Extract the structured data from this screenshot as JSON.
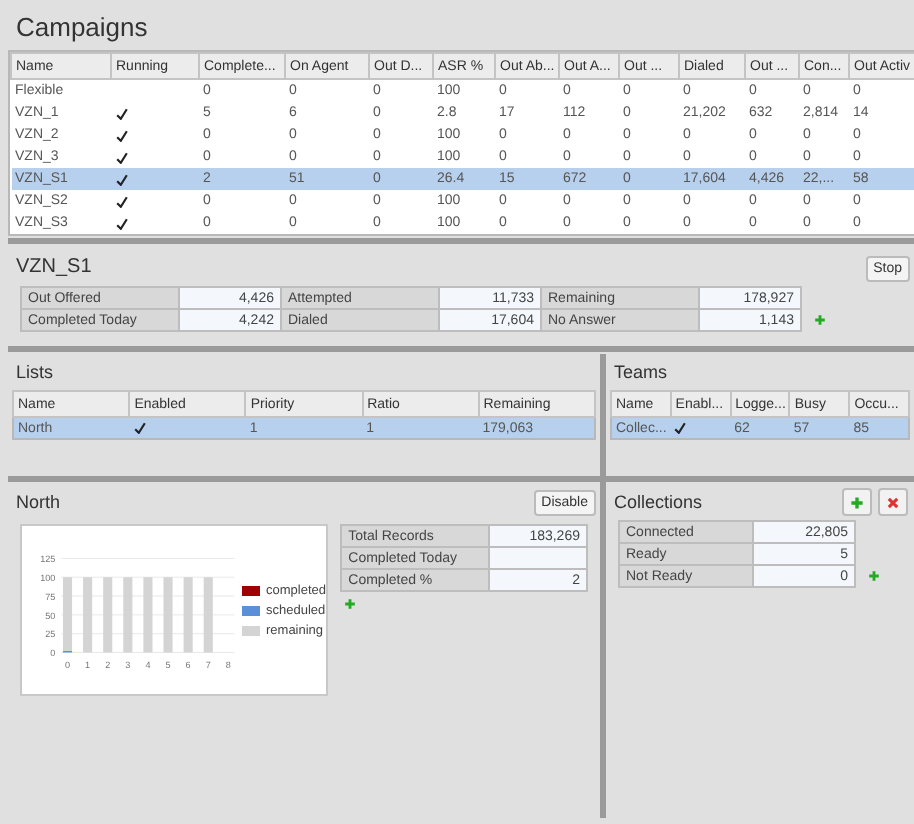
{
  "campaigns": {
    "title": "Campaigns",
    "columns": [
      "Name",
      "Running",
      "Complete...",
      "On Agent",
      "Out D...",
      "ASR %",
      "Out Ab...",
      "Out A...",
      "Out ...",
      "Dialed",
      "Out ...",
      "Con...",
      "Out Activ"
    ],
    "rows": [
      {
        "name": "Flexible",
        "running": false,
        "selected": false,
        "values": [
          "0",
          "0",
          "0",
          "100",
          "0",
          "0",
          "0",
          "0",
          "0",
          "0",
          "0"
        ]
      },
      {
        "name": "VZN_1",
        "running": true,
        "selected": false,
        "values": [
          "5",
          "6",
          "0",
          "2.8",
          "17",
          "112",
          "0",
          "21,202",
          "632",
          "2,814",
          "14"
        ]
      },
      {
        "name": "VZN_2",
        "running": true,
        "selected": false,
        "values": [
          "0",
          "0",
          "0",
          "100",
          "0",
          "0",
          "0",
          "0",
          "0",
          "0",
          "0"
        ]
      },
      {
        "name": "VZN_3",
        "running": true,
        "selected": false,
        "values": [
          "0",
          "0",
          "0",
          "100",
          "0",
          "0",
          "0",
          "0",
          "0",
          "0",
          "0"
        ]
      },
      {
        "name": "VZN_S1",
        "running": true,
        "selected": true,
        "values": [
          "2",
          "51",
          "0",
          "26.4",
          "15",
          "672",
          "0",
          "17,604",
          "4,426",
          "22,...",
          "58"
        ]
      },
      {
        "name": "VZN_S2",
        "running": true,
        "selected": false,
        "values": [
          "0",
          "0",
          "0",
          "100",
          "0",
          "0",
          "0",
          "0",
          "0",
          "0",
          "0"
        ]
      },
      {
        "name": "VZN_S3",
        "running": true,
        "selected": false,
        "values": [
          "0",
          "0",
          "0",
          "100",
          "0",
          "0",
          "0",
          "0",
          "0",
          "0",
          "0"
        ]
      }
    ]
  },
  "summary": {
    "title": "VZN_S1",
    "stop_button": "Stop",
    "stats": [
      [
        {
          "label": "Out Offered",
          "value": "4,426"
        },
        {
          "label": "Attempted",
          "value": "11,733"
        },
        {
          "label": "Remaining",
          "value": "178,927"
        }
      ],
      [
        {
          "label": "Completed Today",
          "value": "4,242"
        },
        {
          "label": "Dialed",
          "value": "17,604"
        },
        {
          "label": "No Answer",
          "value": "1,143"
        }
      ]
    ]
  },
  "lists": {
    "title": "Lists",
    "columns": [
      "Name",
      "Enabled",
      "Priority",
      "Ratio",
      "Remaining"
    ],
    "rows": [
      {
        "name": "North",
        "enabled": true,
        "selected": true,
        "values": [
          "1",
          "1",
          "179,063"
        ]
      }
    ]
  },
  "teams": {
    "title": "Teams",
    "columns": [
      "Name",
      "Enabl...",
      "Logge...",
      "Busy",
      "Occu..."
    ],
    "rows": [
      {
        "name": "Collec...",
        "enabled": true,
        "selected": true,
        "values": [
          "62",
          "57",
          "85"
        ]
      }
    ]
  },
  "north": {
    "title": "North",
    "disable_button": "Disable",
    "chart_data": {
      "type": "bar",
      "stacked": true,
      "grid": true,
      "categories": [
        "0",
        "1",
        "2",
        "3",
        "4",
        "5",
        "6",
        "7",
        "8"
      ],
      "yticks": [
        0,
        25,
        50,
        75,
        100,
        125
      ],
      "ylim": [
        0,
        125
      ],
      "series": [
        {
          "name": "completed",
          "color": "#a00000",
          "values": [
            0,
            0,
            0,
            0,
            0,
            0,
            0,
            0,
            null
          ]
        },
        {
          "name": "scheduled",
          "color": "#5b8fd8",
          "values": [
            2,
            0,
            0,
            0,
            0,
            0,
            0,
            0,
            null
          ]
        },
        {
          "name": "remaining",
          "color": "#d4d4d4",
          "values": [
            98,
            100,
            100,
            100,
            100,
            100,
            100,
            100,
            null
          ]
        }
      ]
    },
    "stats": [
      {
        "label": "Total Records",
        "value": "183,269"
      },
      {
        "label": "Completed Today"
      },
      {
        "label": "Completed %",
        "value": "2"
      }
    ]
  },
  "collections": {
    "title": "Collections",
    "stats": [
      {
        "label": "Connected",
        "value": "22,805"
      },
      {
        "label": "Ready",
        "value": "5"
      },
      {
        "label": "Not Ready",
        "value": "0"
      }
    ]
  }
}
